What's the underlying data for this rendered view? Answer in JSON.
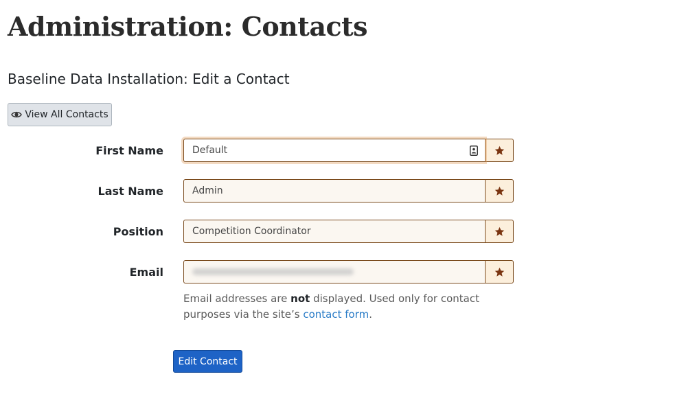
{
  "page": {
    "title": "Administration: Contacts",
    "subtitle": "Baseline Data Installation: Edit a Contact"
  },
  "toolbar": {
    "view_all_label": "View All Contacts"
  },
  "form": {
    "fields": [
      {
        "label": "First Name",
        "value": "Default"
      },
      {
        "label": "Last Name",
        "value": "Admin"
      },
      {
        "label": "Position",
        "value": "Competition Coordinator"
      },
      {
        "label": "Email",
        "value": ""
      }
    ],
    "help": {
      "part1": "Email addresses are ",
      "bold": "not",
      "part2": " displayed. Used only for contact purposes via the site’s ",
      "link": "contact form",
      "part3": "."
    },
    "submit_label": "Edit Contact"
  },
  "icons": {
    "view": "eye-icon",
    "required": "star-icon",
    "autofill": "contact-card-icon"
  },
  "colors": {
    "primary": "#1e63c6",
    "field_border": "#7a4a1c",
    "star": "#7a3410",
    "addon_bg": "#fcefdc",
    "link": "#2a7cc7"
  }
}
